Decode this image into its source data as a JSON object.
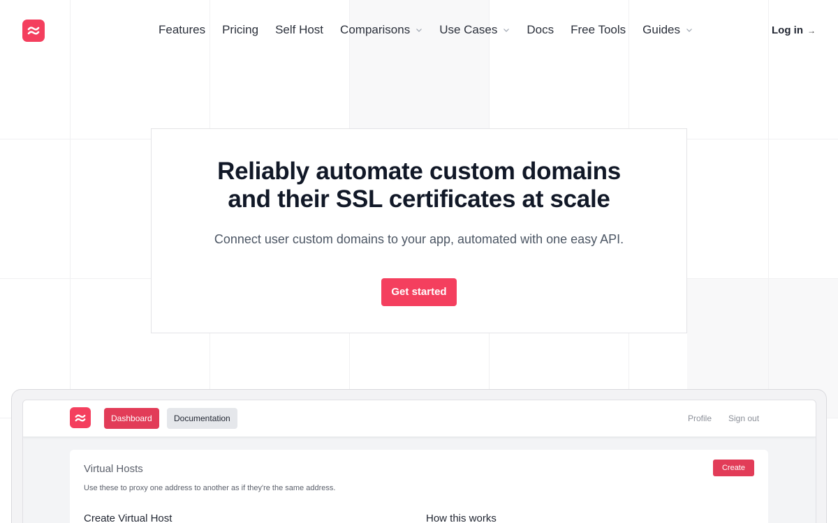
{
  "brand": {
    "color": "#f43f5e",
    "logo_icon": "wave-logo-icon"
  },
  "nav": {
    "items": [
      {
        "label": "Features",
        "dropdown": false
      },
      {
        "label": "Pricing",
        "dropdown": false
      },
      {
        "label": "Self Host",
        "dropdown": false
      },
      {
        "label": "Comparisons",
        "dropdown": true
      },
      {
        "label": "Use Cases",
        "dropdown": true
      },
      {
        "label": "Docs",
        "dropdown": false
      },
      {
        "label": "Free Tools",
        "dropdown": false
      },
      {
        "label": "Guides",
        "dropdown": true
      }
    ],
    "login_label": "Log in",
    "login_arrow": "→"
  },
  "hero": {
    "title_line1": "Reliably automate custom domains",
    "title_line2": "and their SSL certificates at scale",
    "subtitle": "Connect user custom domains to your app, automated with one easy API.",
    "cta_label": "Get started"
  },
  "app_preview": {
    "dashboard_label": "Dashboard",
    "documentation_label": "Documentation",
    "profile_label": "Profile",
    "signout_label": "Sign out",
    "panel_title": "Virtual Hosts",
    "panel_description": "Use these to proxy one address to another as if they're the same address.",
    "create_label": "Create",
    "col_left_heading": "Create Virtual Host",
    "col_right_heading": "How this works"
  }
}
